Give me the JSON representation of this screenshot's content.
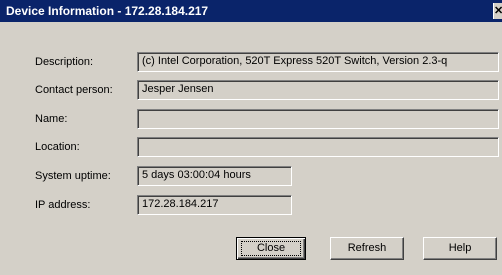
{
  "window": {
    "title": "Device Information - 172.28.184.217",
    "close_glyph": "✕"
  },
  "fields": [
    {
      "label": "Description:",
      "value": "(c) Intel Corporation, 520T Express 520T Switch, Version 2.3-q"
    },
    {
      "label": "Contact person:",
      "value": "Jesper Jensen"
    },
    {
      "label": "Name:",
      "value": ""
    },
    {
      "label": "Location:",
      "value": ""
    },
    {
      "label": "System uptime:",
      "value": "5 days  03:00:04 hours"
    },
    {
      "label": "IP address:",
      "value": "172.28.184.217"
    }
  ],
  "buttons": {
    "close": "Close",
    "refresh": "Refresh",
    "help": "Help"
  },
  "colors": {
    "titlebar": "#0a246a",
    "face": "#d4d0c8"
  },
  "icons": {
    "close": "close-icon"
  }
}
